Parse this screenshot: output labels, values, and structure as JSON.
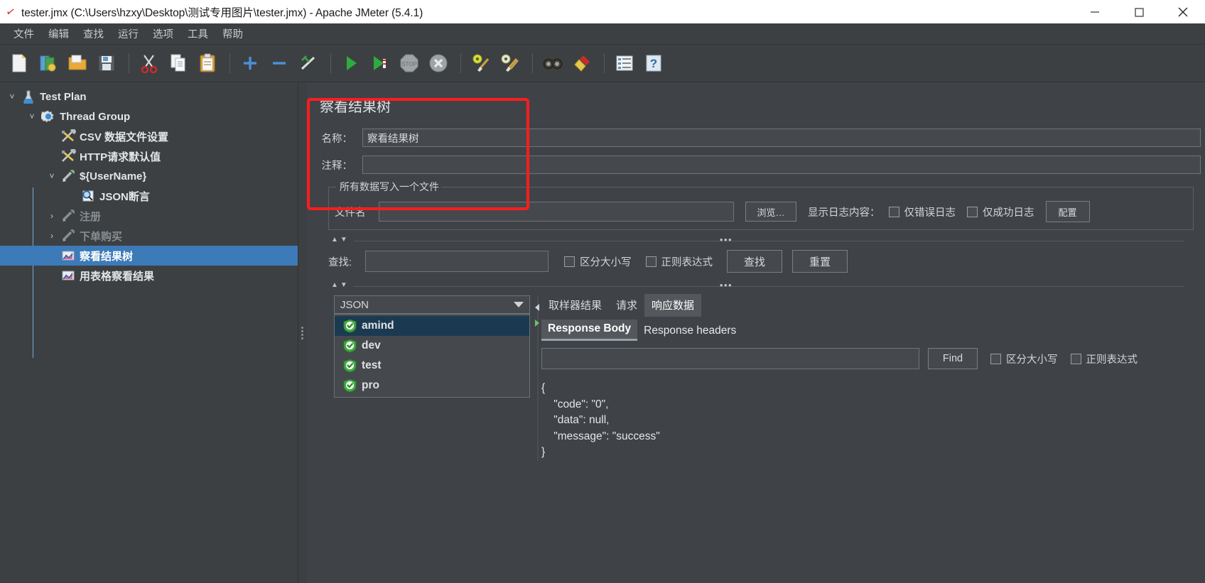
{
  "window": {
    "title": "tester.jmx (C:\\Users\\hzxy\\Desktop\\测试专用图片\\tester.jmx) - Apache JMeter (5.4.1)",
    "icon": "jmeter-feather-icon",
    "minimize": "minimize-icon",
    "maximize": "maximize-icon",
    "close": "close-icon"
  },
  "menu": {
    "items": [
      {
        "label": "文件",
        "name": "menu-file"
      },
      {
        "label": "编辑",
        "name": "menu-edit"
      },
      {
        "label": "查找",
        "name": "menu-search"
      },
      {
        "label": "运行",
        "name": "menu-run"
      },
      {
        "label": "选项",
        "name": "menu-options"
      },
      {
        "label": "工具",
        "name": "menu-tools"
      },
      {
        "label": "帮助",
        "name": "menu-help"
      }
    ]
  },
  "toolbar": {
    "items": [
      {
        "name": "new-icon"
      },
      {
        "name": "templates-icon"
      },
      {
        "name": "open-icon"
      },
      {
        "name": "save-icon"
      },
      {
        "name": "cut-icon"
      },
      {
        "name": "copy-icon"
      },
      {
        "name": "paste-icon"
      },
      {
        "name": "expand-icon"
      },
      {
        "name": "collapse-icon"
      },
      {
        "name": "toggle-icon"
      },
      {
        "name": "start-icon"
      },
      {
        "name": "start-no-pauses-icon"
      },
      {
        "name": "stop-icon"
      },
      {
        "name": "shutdown-icon"
      },
      {
        "name": "clear-icon"
      },
      {
        "name": "clear-all-icon"
      },
      {
        "name": "search-icon"
      },
      {
        "name": "search-reset-icon"
      },
      {
        "name": "function-helper-icon"
      },
      {
        "name": "help-icon"
      }
    ]
  },
  "tree": {
    "nodes": [
      {
        "label": "Test Plan",
        "icon": "test-plan-icon",
        "twisty": "chevron-down",
        "depth": 0,
        "selected": false,
        "dim": false
      },
      {
        "label": "Thread Group",
        "icon": "thread-group-icon",
        "twisty": "chevron-down",
        "depth": 1,
        "selected": false,
        "dim": false
      },
      {
        "label": "CSV 数据文件设置",
        "icon": "config-element-icon",
        "twisty": "",
        "depth": 2,
        "selected": false,
        "dim": false
      },
      {
        "label": "HTTP请求默认值",
        "icon": "config-element-icon",
        "twisty": "",
        "depth": 2,
        "selected": false,
        "dim": false
      },
      {
        "label": "${UserName}",
        "icon": "sampler-icon",
        "twisty": "chevron-down",
        "depth": 2,
        "selected": false,
        "dim": false
      },
      {
        "label": "JSON断言",
        "icon": "assertion-icon",
        "twisty": "",
        "depth": 3,
        "selected": false,
        "dim": false
      },
      {
        "label": "注册",
        "icon": "sampler-icon",
        "twisty": "chevron-right",
        "depth": 2,
        "selected": false,
        "dim": true
      },
      {
        "label": "下单购买",
        "icon": "sampler-icon",
        "twisty": "chevron-right",
        "depth": 2,
        "selected": false,
        "dim": true
      },
      {
        "label": "察看结果树",
        "icon": "listener-icon",
        "twisty": "",
        "depth": 2,
        "selected": true,
        "dim": false
      },
      {
        "label": "用表格察看结果",
        "icon": "listener-icon",
        "twisty": "",
        "depth": 2,
        "selected": false,
        "dim": false
      }
    ]
  },
  "panel": {
    "title": "察看结果树",
    "name_label": "名称：",
    "name_value": "察看结果树",
    "comment_label": "注释：",
    "comment_value": "",
    "filegroup": {
      "legend": "所有数据写入一个文件",
      "filename_label": "文件名",
      "filename_value": "",
      "browse_button": "浏览…",
      "log_content_label": "显示日志内容：",
      "errors_only": "仅错误日志",
      "success_only": "仅成功日志",
      "configure_button": "配置"
    },
    "search": {
      "label": "查找:",
      "value": "",
      "case_sensitive": "区分大小写",
      "regex": "正则表达式",
      "find_button": "查找",
      "reset_button": "重置"
    },
    "renderer": {
      "selected": "JSON",
      "options": [
        "amind",
        "dev",
        "test",
        "pro"
      ]
    },
    "dropdown": {
      "items": [
        {
          "label": "amind",
          "icon": "green-shield-check-icon",
          "highlighted": true
        },
        {
          "label": "dev",
          "icon": "green-shield-check-icon",
          "highlighted": false
        },
        {
          "label": "test",
          "icon": "green-shield-check-icon",
          "highlighted": false
        },
        {
          "label": "pro",
          "icon": "green-shield-check-icon",
          "highlighted": false
        }
      ]
    },
    "tabs": [
      {
        "label": "取样器结果",
        "active": false
      },
      {
        "label": "请求",
        "active": false
      },
      {
        "label": "响应数据",
        "active": true
      }
    ],
    "subtabs": [
      {
        "label": "Response Body",
        "active": true
      },
      {
        "label": "Response headers",
        "active": false
      }
    ],
    "find": {
      "value": "",
      "button": "Find",
      "case_sensitive": "区分大小写",
      "regex": "正则表达式"
    },
    "response_body": "{\n    \"code\": \"0\",\n    \"data\": null,\n    \"message\": \"success\"\n}"
  }
}
